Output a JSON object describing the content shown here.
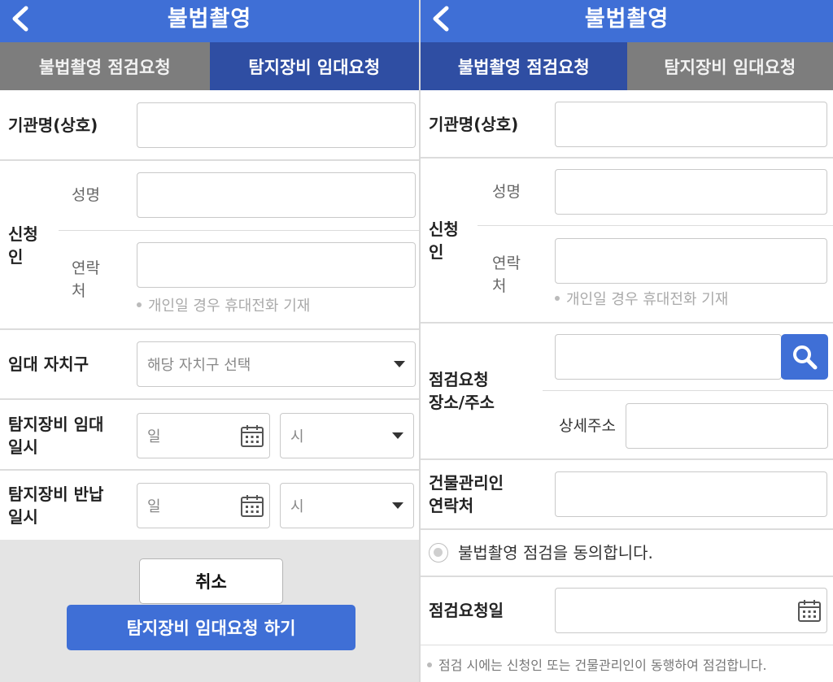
{
  "left": {
    "header": {
      "title": "불법촬영"
    },
    "tabs": [
      {
        "label": "불법촬영 점검요청",
        "active": false
      },
      {
        "label": "탐지장비 임대요청",
        "active": true
      }
    ],
    "form": {
      "org_label": "기관명(상호)",
      "org_value": "",
      "applicant_label_line1": "신청",
      "applicant_label_line2": "인",
      "name_label": "성명",
      "name_value": "",
      "contact_label_line1": "연락",
      "contact_label_line2": "처",
      "contact_value": "",
      "contact_hint": "개인일 경우 휴대전화 기재",
      "district_label": "임대 자치구",
      "district_select": "해당 자치구 선택",
      "rent_label_line1": "탐지장비 임대",
      "rent_label_line2": "일시",
      "rent_date_placeholder": "일",
      "rent_time_placeholder": "시",
      "return_label_line1": "탐지장비 반납",
      "return_label_line2": "일시",
      "return_date_placeholder": "일",
      "return_time_placeholder": "시"
    },
    "buttons": {
      "cancel": "취소",
      "submit": "탐지장비 임대요청 하기"
    }
  },
  "right": {
    "header": {
      "title": "불법촬영"
    },
    "tabs": [
      {
        "label": "불법촬영 점검요청",
        "active": true
      },
      {
        "label": "탐지장비 임대요청",
        "active": false
      }
    ],
    "form": {
      "org_label": "기관명(상호)",
      "org_value": "",
      "applicant_label_line1": "신청",
      "applicant_label_line2": "인",
      "name_label": "성명",
      "name_value": "",
      "contact_label_line1": "연락",
      "contact_label_line2": "처",
      "contact_value": "",
      "contact_hint": "개인일 경우 휴대전화 기재",
      "place_label_line1": "점검요청",
      "place_label_line2": "장소/주소",
      "address_value": "",
      "detail_address_label": "상세주소",
      "detail_address_value": "",
      "manager_label_line1": "건물관리인",
      "manager_label_line2": "연락처",
      "manager_value": "",
      "agree_text": "불법촬영 점검을 동의합니다.",
      "inspection_date_label": "점검요청일",
      "inspection_date_value": "",
      "footnote": "점검 시에는 신청인 또는 건물관리인이 동행하여 점검합니다."
    }
  },
  "colors": {
    "primary": "#3f6fd6",
    "active_tab": "#2f4ea3",
    "inactive_tab": "#7d7d7d"
  },
  "icons": [
    "back-arrow-icon",
    "calendar-icon",
    "dropdown-caret-icon",
    "search-icon",
    "radio-icon"
  ]
}
